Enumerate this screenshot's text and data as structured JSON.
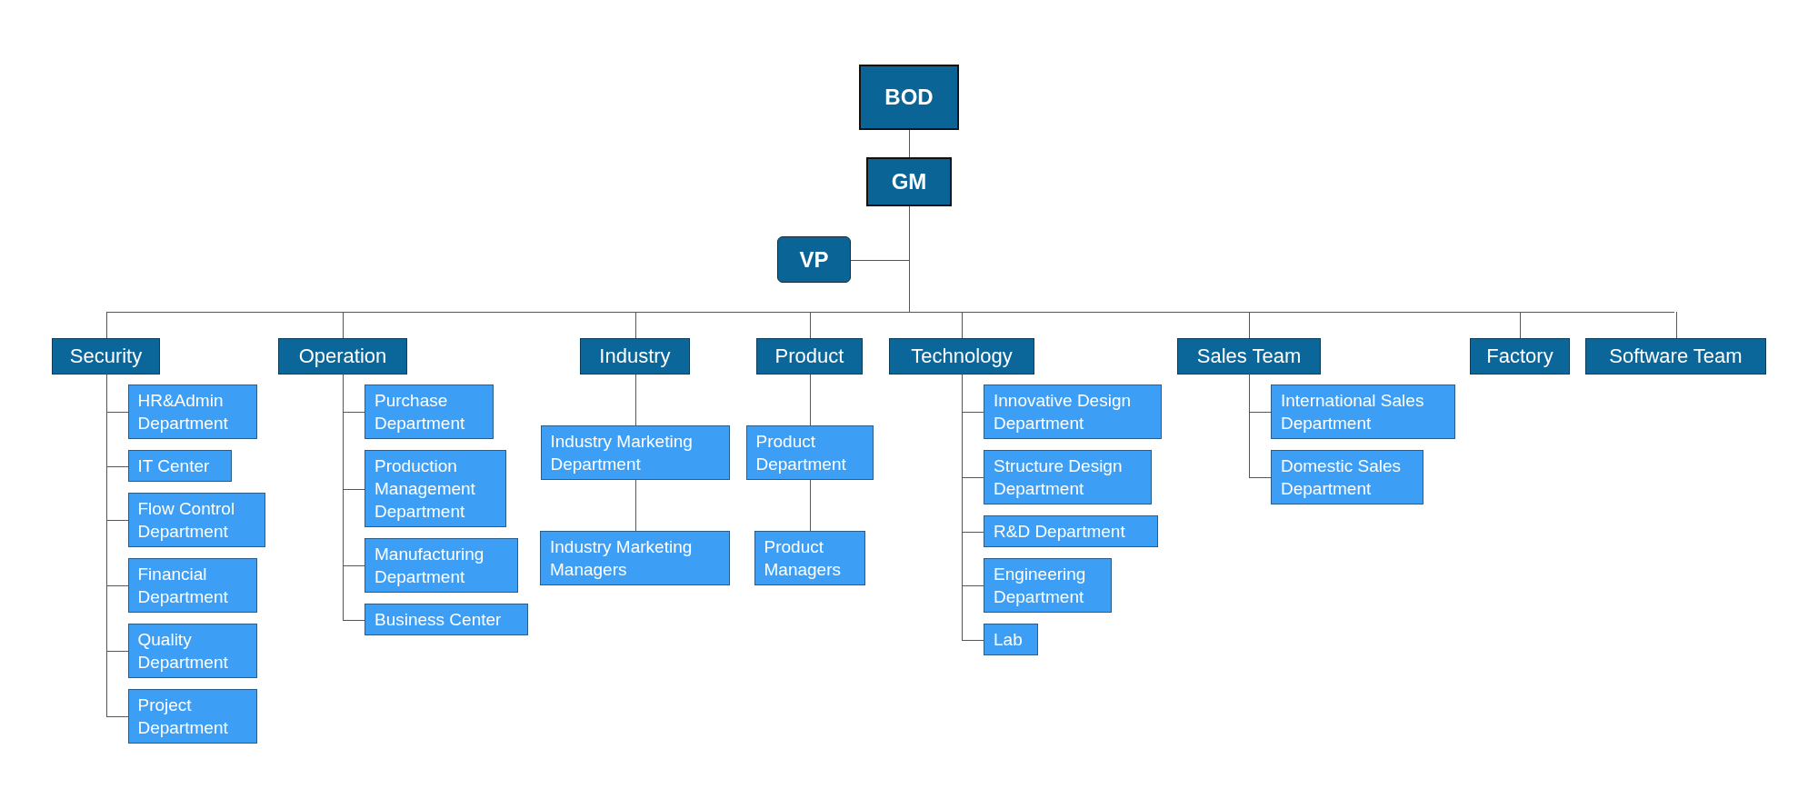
{
  "top": [
    {
      "label": "BOD"
    },
    {
      "label": "GM"
    }
  ],
  "assistant": {
    "label": "VP"
  },
  "departments": [
    {
      "label": "Security",
      "kind": "list",
      "children": [
        {
          "label": "HR&Admin Department"
        },
        {
          "label": "IT Center"
        },
        {
          "label": "Flow Control Department"
        },
        {
          "label": "Financial Department"
        },
        {
          "label": "Quality Department"
        },
        {
          "label": "Project Department"
        }
      ]
    },
    {
      "label": "Operation",
      "kind": "list",
      "children": [
        {
          "label": "Purchase Department"
        },
        {
          "label": "Production Management Department"
        },
        {
          "label": "Manufacturing Department"
        },
        {
          "label": "Business Center"
        }
      ]
    },
    {
      "label": "Industry",
      "kind": "chain",
      "children": [
        {
          "label": "Industry Marketing Department"
        },
        {
          "label": "Industry Marketing Managers"
        }
      ]
    },
    {
      "label": "Product",
      "kind": "chain",
      "children": [
        {
          "label": "Product Department"
        },
        {
          "label": "Product Managers"
        }
      ]
    },
    {
      "label": "Technology",
      "kind": "list",
      "children": [
        {
          "label": "Innovative Design Department"
        },
        {
          "label": "Structure Design Department"
        },
        {
          "label": "R&D Department"
        },
        {
          "label": "Engineering Department"
        },
        {
          "label": "Lab"
        }
      ]
    },
    {
      "label": "Sales Team",
      "kind": "list",
      "children": [
        {
          "label": "International Sales Department"
        },
        {
          "label": "Domestic Sales Department"
        }
      ]
    },
    {
      "label": "Factory"
    },
    {
      "label": "Software Team"
    }
  ]
}
